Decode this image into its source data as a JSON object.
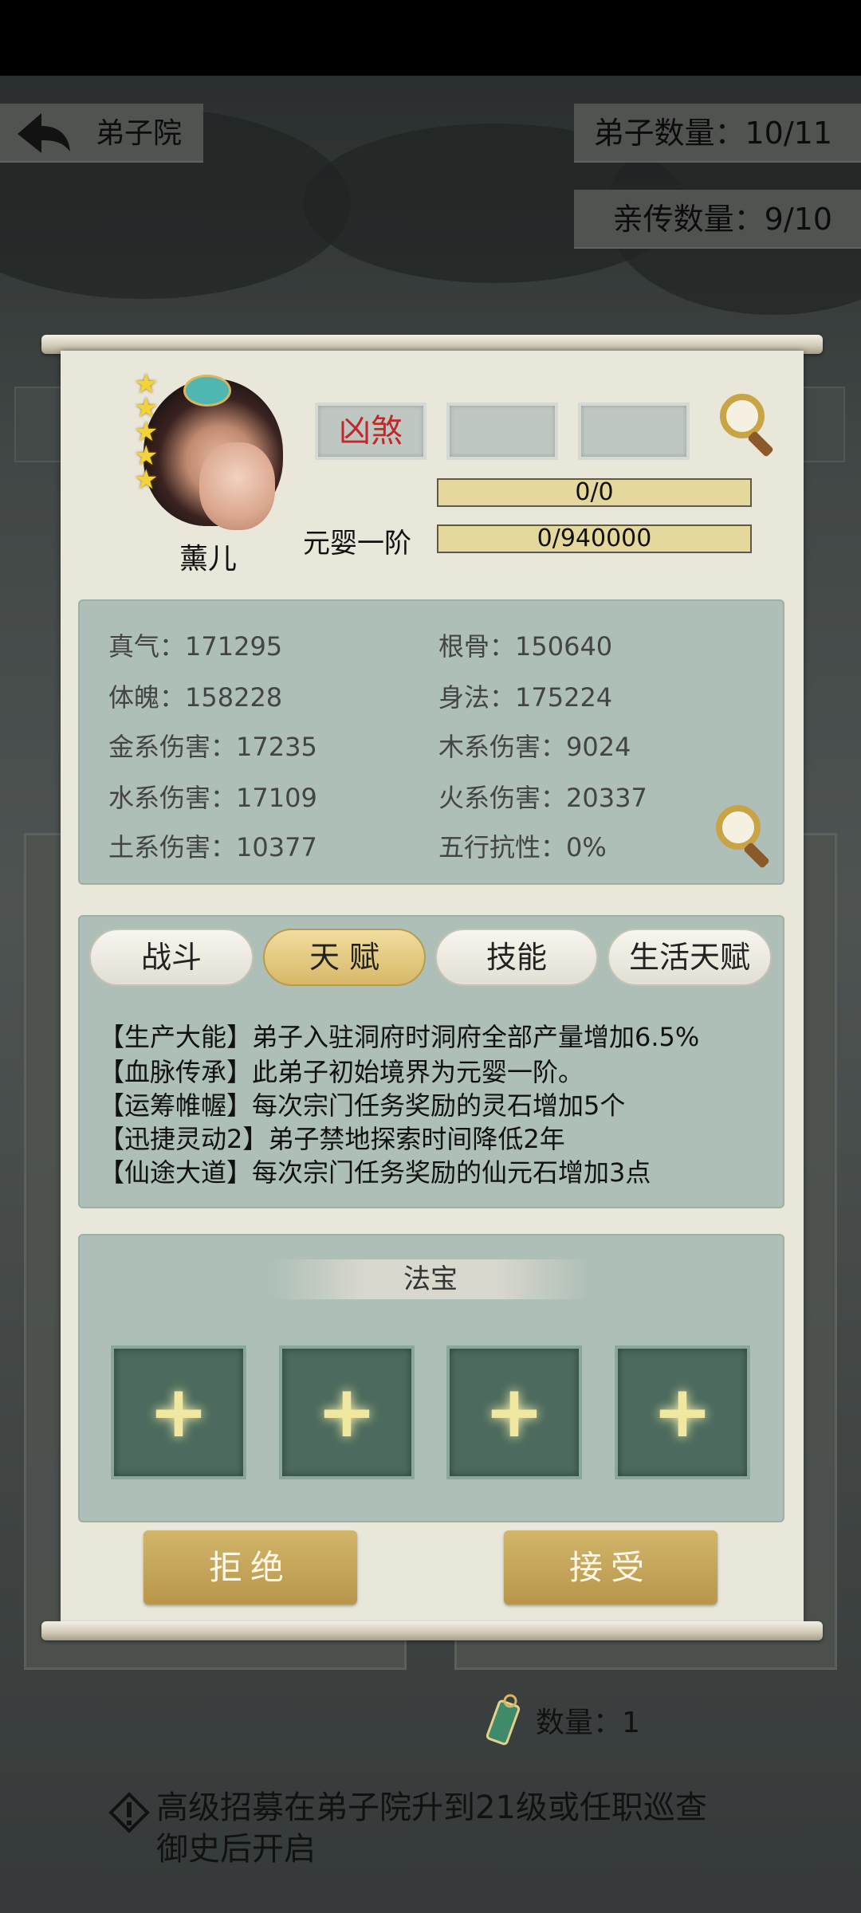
{
  "header": {
    "title": "弟子院",
    "disciple_count": "弟子数量：10/11",
    "direct_count": "亲传数量：9/10"
  },
  "character": {
    "name": "薰儿",
    "stars": 5,
    "tags": [
      "凶煞",
      "",
      ""
    ],
    "bar1": "0/0",
    "realm": "元婴一阶",
    "bar2": "0/940000"
  },
  "stats": {
    "zhenqi": "真气：171295",
    "gengu": "根骨：150640",
    "tipo": "体魄：158228",
    "shenfa": "身法：175224",
    "jin": "金系伤害：17235",
    "mu": "木系伤害：9024",
    "shui": "水系伤害：17109",
    "huo": "火系伤害：20337",
    "tu": "土系伤害：10377",
    "kang": "五行抗性：0%"
  },
  "tabs": [
    "战斗",
    "天 赋",
    "技能",
    "生活天赋"
  ],
  "active_tab": 1,
  "talents": [
    "【生产大能】弟子入驻洞府时洞府全部产量增加6.5%",
    "【血脉传承】此弟子初始境界为元婴一阶。",
    "【运筹帷幄】每次宗门任务奖励的灵石增加5个",
    "【迅捷灵动2】弟子禁地探索时间降低2年",
    "【仙途大道】每次宗门任务奖励的仙元石增加3点"
  ],
  "fabao": {
    "title": "法宝",
    "slots": [
      "+",
      "+",
      "+",
      "+"
    ]
  },
  "buttons": {
    "reject": "拒绝",
    "accept": "接受"
  },
  "footer": {
    "quantity": "数量：1",
    "notice": "高级招募在弟子院升到21级或任职巡查御史后开启"
  },
  "colors": {
    "tag_red": "#c0282a",
    "button_gold": "#c5a55a",
    "panel": "#e9e6da",
    "section": "#adbfb6"
  }
}
